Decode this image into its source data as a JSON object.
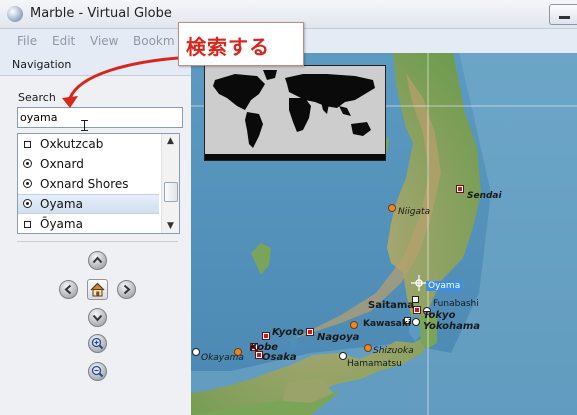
{
  "window": {
    "title": "Marble - Virtual Globe"
  },
  "menu": [
    "File",
    "Edit",
    "View",
    "Bookm"
  ],
  "navigation": {
    "title": "Navigation",
    "search_label": "Search",
    "search_value": "oyama",
    "results": [
      {
        "label": "Oxkutzcab",
        "icon": "square-marker-icon"
      },
      {
        "label": "Oxnard",
        "icon": "circle-marker-icon"
      },
      {
        "label": "Oxnard Shores",
        "icon": "circle-marker-icon"
      },
      {
        "label": "Oyama",
        "icon": "circle-marker-icon",
        "selected": true
      },
      {
        "label": "Ōyama",
        "icon": "square-marker-icon"
      }
    ]
  },
  "annotation": {
    "callout_text": "検索する",
    "color": "#d9261c"
  },
  "map": {
    "labels": {
      "sendai": "Sendai",
      "niigata": "Niigata",
      "oyama": "Oyama",
      "saitama": "Saitama",
      "funabashi": "Funabashi",
      "tokyo": "Tokyo",
      "kawasaki": "Kawasaki",
      "yokohama": "Yokohama",
      "kyoto": "Kyoto",
      "nagoya": "Nagoya",
      "kobe": "Kobe",
      "osaka": "Osaka",
      "okayama": "Okayama",
      "shizuoka": "Shizuoka",
      "hamamatsu": "Hamamatsu"
    }
  },
  "colors": {
    "sea": "#4f8fb8",
    "land_green": "#7aa558",
    "land_tan": "#c9b688",
    "selection": "#3d8ee8"
  }
}
